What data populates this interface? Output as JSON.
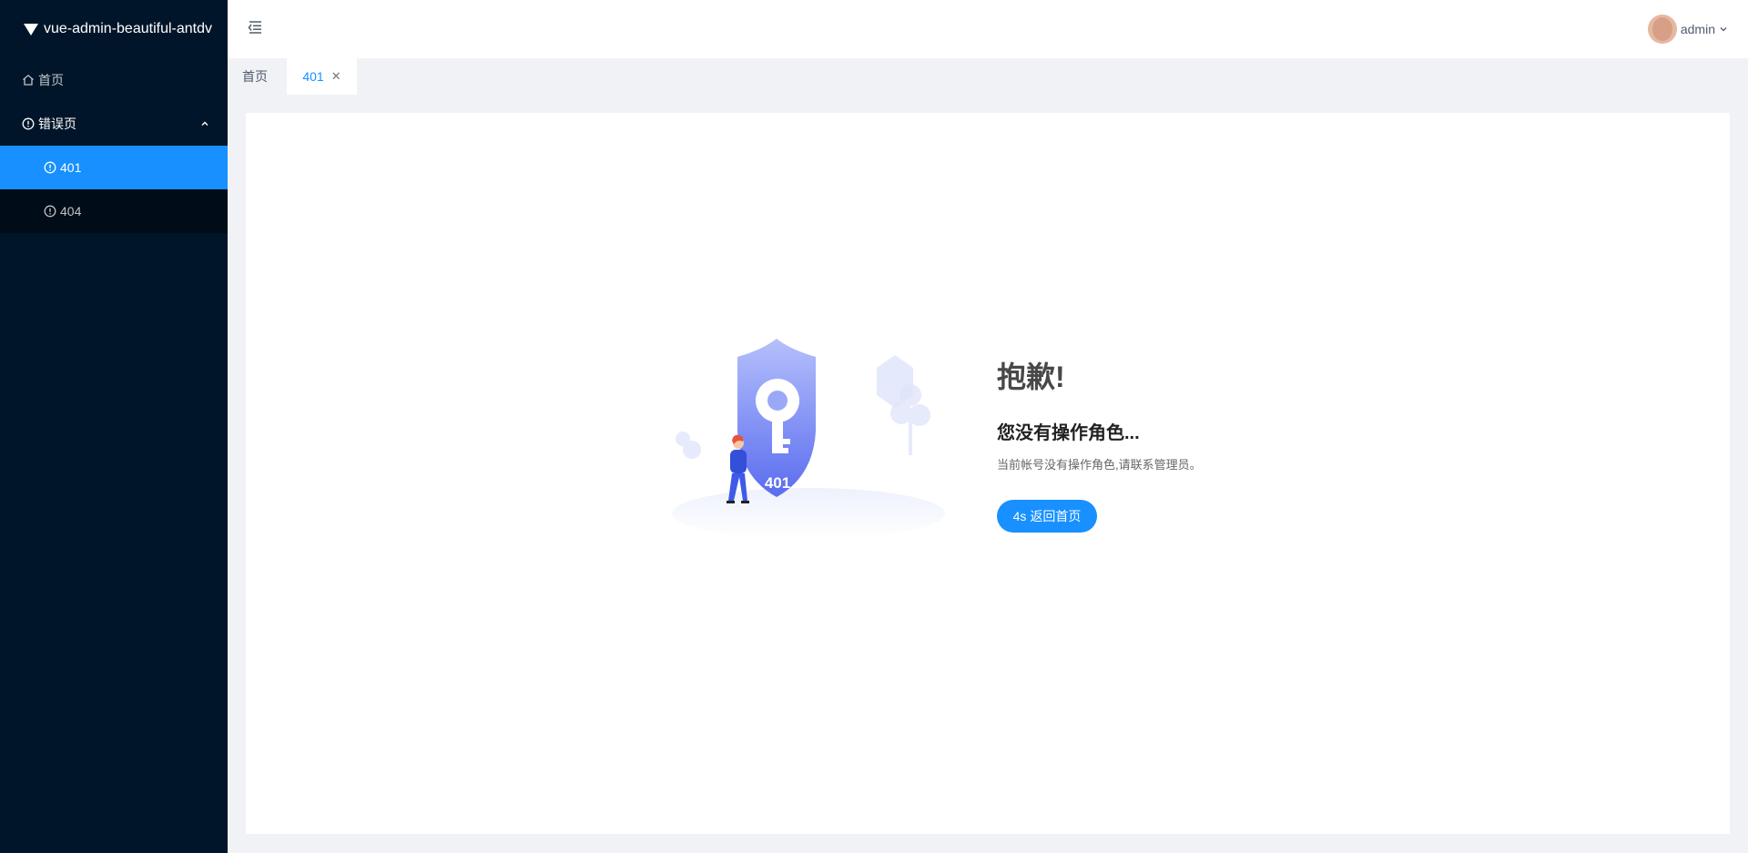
{
  "sidebar": {
    "logo_text": "vue-admin-beautiful-antdv",
    "items": [
      {
        "label": "首页",
        "icon": "home-icon"
      },
      {
        "label": "错误页",
        "icon": "exclamation-circle-icon",
        "expanded": true,
        "children": [
          {
            "label": "401",
            "icon": "exclamation-circle-icon",
            "active": true
          },
          {
            "label": "404",
            "icon": "exclamation-circle-icon",
            "active": false
          }
        ]
      }
    ]
  },
  "header": {
    "user_name": "admin"
  },
  "tabs": [
    {
      "label": "首页",
      "active": false
    },
    {
      "label": "401",
      "active": true
    }
  ],
  "error_page": {
    "shield_label": "401",
    "oops": "抱歉!",
    "headline": "您没有操作角色...",
    "info": "当前帐号没有操作角色,请联系管理员。",
    "countdown": "4s",
    "button_label": "返回首页"
  },
  "colors": {
    "sidebar_bg": "#001529",
    "primary": "#1890ff",
    "page_bg": "#f0f2f5"
  }
}
